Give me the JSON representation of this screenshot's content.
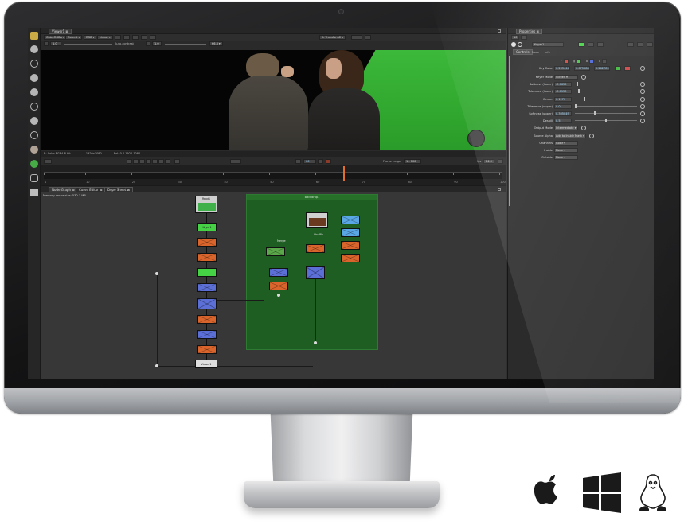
{
  "viewer": {
    "tab": "Viewer1 ⊠",
    "controls": [
      "Color.RGBA ▾",
      "Color.A ▾",
      "RGB ▾",
      "Linear ▾"
    ],
    "auto_contrast": "Auto-contrast",
    "gamma": "1.0",
    "gain": "1.0",
    "zoom": "fit",
    "percent": "66.8 ▾",
    "transform": "A: Transform2 ▾",
    "info_left": "B: Color.RGBA 8-bit",
    "info_format": "1920x1080",
    "info_rgb": "RoI: 0 0 1920 1080",
    "current_frame": "66",
    "frame_range_label": "Frame range",
    "frame_range": "1 - 100",
    "fps_label": "fps",
    "fps": "24.0",
    "timeline_ticks": [
      "1",
      "10",
      "20",
      "30",
      "40",
      "50",
      "60",
      "70",
      "80",
      "90",
      "100"
    ],
    "playhead_frame": 66
  },
  "graph": {
    "tabs": [
      "Node Graph ⊠",
      "Curve Editor ⊠",
      "Dope Sheet ⊠"
    ],
    "memory": "Memory cache size: 530.1 MB",
    "backdrop_title": "Backdrop1",
    "labels": {
      "read1": "Read1",
      "viewer1": "Viewer1",
      "roto1": "Roto1",
      "keyer1": "Keyer1",
      "read2": "Read2",
      "merge": "Merge",
      "shuffle": "Shuffle",
      "matte": "Matte"
    }
  },
  "properties": {
    "tab": "Properties ⊠",
    "count": "10",
    "node_name": "Keyer1",
    "subtabs": [
      "Controls",
      "Node",
      "Info"
    ],
    "key_color_label": "Key Color",
    "key_color": [
      "0.233444",
      "0.675588",
      "0.262789"
    ],
    "channels_top": [
      "r",
      "g",
      "b",
      "a"
    ],
    "rows": [
      {
        "label": "Keyer Mode",
        "value": "Screen ▾",
        "kind": "menu"
      },
      {
        "label": "Softness (lower)",
        "value": "-0.0650",
        "kind": "slider",
        "pos": 0.03
      },
      {
        "label": "Tolerance (lower)",
        "value": "-0.0150",
        "kind": "slider",
        "pos": 0.05
      },
      {
        "label": "Center",
        "value": "0.1270",
        "kind": "slider",
        "pos": 0.14
      },
      {
        "label": "Tolerance (upper)",
        "value": "0.0",
        "kind": "slider",
        "pos": 0.0
      },
      {
        "label": "Softness (upper)",
        "value": "0.305049",
        "kind": "slider",
        "pos": 0.31
      },
      {
        "label": "Despill",
        "value": "0.5",
        "kind": "slider",
        "pos": 0.5
      },
      {
        "label": "Output Mode",
        "value": "Intermediate ▾",
        "kind": "menu"
      },
      {
        "label": "Source Alpha",
        "value": "Add to Inside Mask ▾",
        "kind": "menu"
      },
      {
        "label": "Channels",
        "value": "Color ▾",
        "kind": "menu"
      },
      {
        "label": "Inside",
        "value": "None ▾",
        "kind": "menu"
      },
      {
        "label": "Outside",
        "value": "None ▾",
        "kind": "menu"
      }
    ]
  },
  "os": [
    "apple-icon",
    "windows-icon",
    "linux-icon"
  ],
  "colors": {
    "screen_bg": "#303030",
    "green_screen": "#3cb83a",
    "accent_orange": "#e0702a",
    "keyer_green": "#45d245"
  }
}
